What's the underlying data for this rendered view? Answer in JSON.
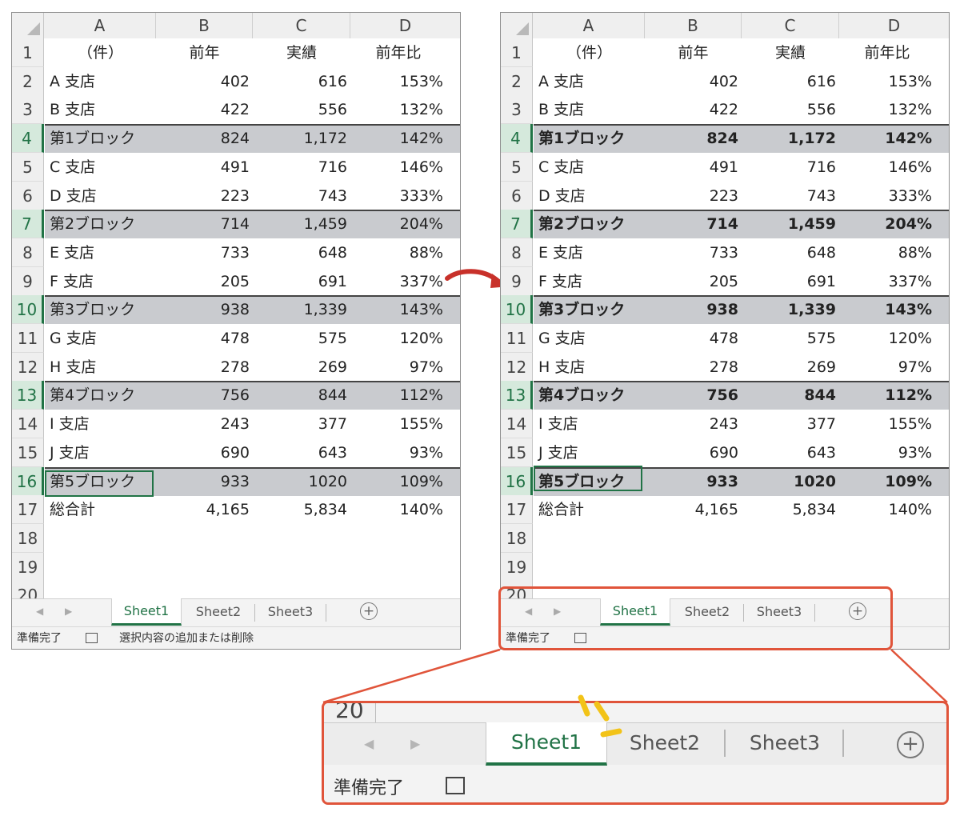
{
  "columns": [
    "A",
    "B",
    "C",
    "D"
  ],
  "row_numbers": [
    "1",
    "2",
    "3",
    "4",
    "5",
    "6",
    "7",
    "8",
    "9",
    "10",
    "11",
    "12",
    "13",
    "14",
    "15",
    "16",
    "17",
    "18",
    "19",
    "20"
  ],
  "rows": [
    {
      "a": "（件）",
      "b": "前年",
      "c": "実績",
      "d": "前年比",
      "type": "header"
    },
    {
      "a": "A 支店",
      "b": "402",
      "c": "616",
      "d": "153%",
      "type": "normal"
    },
    {
      "a": "B 支店",
      "b": "422",
      "c": "556",
      "d": "132%",
      "type": "normal"
    },
    {
      "a": "第1ブロック",
      "b": "824",
      "c": "1,172",
      "d": "142%",
      "type": "block"
    },
    {
      "a": "C 支店",
      "b": "491",
      "c": "716",
      "d": "146%",
      "type": "normal"
    },
    {
      "a": "D 支店",
      "b": "223",
      "c": "743",
      "d": "333%",
      "type": "normal"
    },
    {
      "a": "第2ブロック",
      "b": "714",
      "c": "1,459",
      "d": "204%",
      "type": "block"
    },
    {
      "a": "E 支店",
      "b": "733",
      "c": "648",
      "d": "88%",
      "type": "normal"
    },
    {
      "a": "F 支店",
      "b": "205",
      "c": "691",
      "d": "337%",
      "type": "normal"
    },
    {
      "a": "第3ブロック",
      "b": "938",
      "c": "1,339",
      "d": "143%",
      "type": "block"
    },
    {
      "a": "G 支店",
      "b": "478",
      "c": "575",
      "d": "120%",
      "type": "normal"
    },
    {
      "a": "H 支店",
      "b": "278",
      "c": "269",
      "d": "97%",
      "type": "normal"
    },
    {
      "a": "第4ブロック",
      "b": "756",
      "c": "844",
      "d": "112%",
      "type": "block"
    },
    {
      "a": "I 支店",
      "b": "243",
      "c": "377",
      "d": "155%",
      "type": "normal"
    },
    {
      "a": "J 支店",
      "b": "690",
      "c": "643",
      "d": "93%",
      "type": "normal"
    },
    {
      "a": "第5ブロック",
      "b": "933",
      "c": "1020",
      "d": "109%",
      "type": "block"
    },
    {
      "a": "総合計",
      "b": "4,165",
      "c": "5,834",
      "d": "140%",
      "type": "total"
    },
    {
      "a": "",
      "b": "",
      "c": "",
      "d": "",
      "type": "empty"
    },
    {
      "a": "",
      "b": "",
      "c": "",
      "d": "",
      "type": "empty"
    },
    {
      "a": "",
      "b": "",
      "c": "",
      "d": "",
      "type": "empty"
    }
  ],
  "tabs": {
    "nav_prev": "◀",
    "nav_next": "▶",
    "sheets": [
      "Sheet1",
      "Sheet2",
      "Sheet3"
    ],
    "add": "+"
  },
  "status": {
    "ready": "準備完了",
    "left_message": "選択内容の追加または削除"
  },
  "colors": {
    "accent": "#217346",
    "callout": "#e0543a",
    "arrow": "#c8312a",
    "highlight": "#c9cbcf",
    "sparkle": "#f2c318"
  }
}
